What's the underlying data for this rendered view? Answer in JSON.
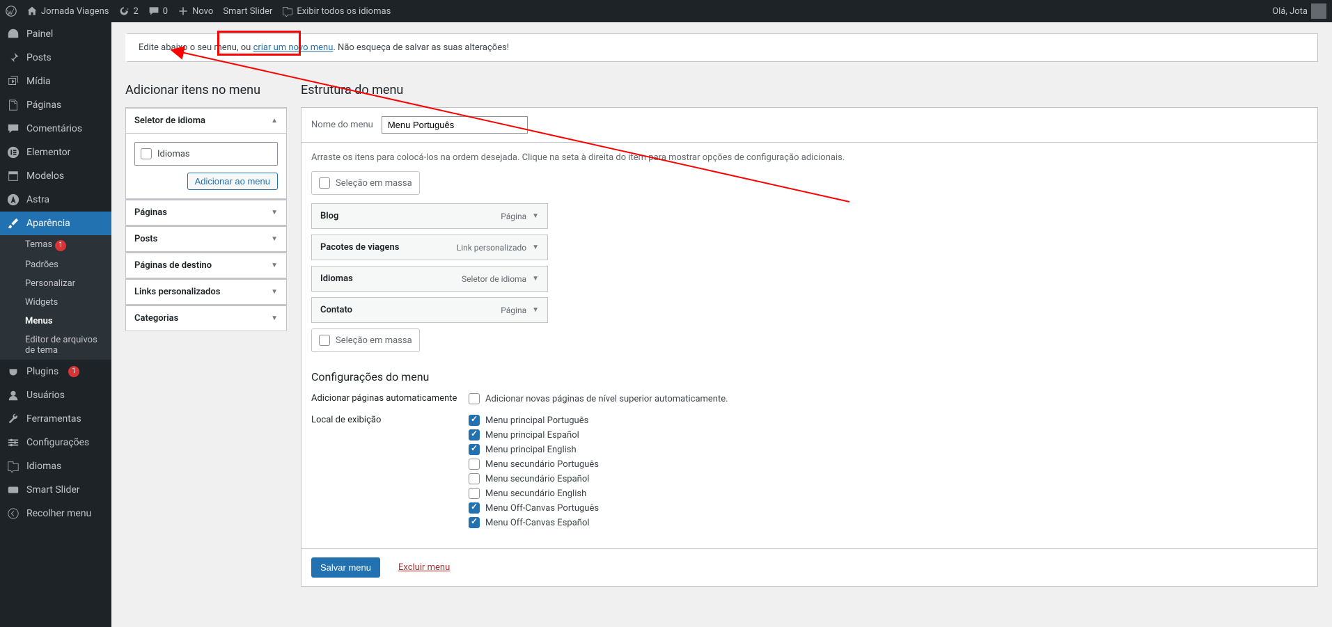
{
  "adminbar": {
    "site": "Jornada Viagens",
    "updates": "2",
    "comments": "0",
    "new": "Novo",
    "smartslider": "Smart Slider",
    "showall": "Exibir todos os idiomas",
    "greeting": "Olá, Jota"
  },
  "sidemenu": {
    "dashboard": "Painel",
    "posts": "Posts",
    "media": "Mídia",
    "pages": "Páginas",
    "comments": "Comentários",
    "elementor": "Elementor",
    "templates": "Modelos",
    "astra": "Astra",
    "appearance": "Aparência",
    "appearance_sub": {
      "themes": "Temas",
      "themes_badge": "1",
      "patterns": "Padrões",
      "customize": "Personalizar",
      "widgets": "Widgets",
      "menus": "Menus",
      "editor": "Editor de arquivos de tema"
    },
    "plugins": "Plugins",
    "plugins_badge": "1",
    "users": "Usuários",
    "tools": "Ferramentas",
    "settings": "Configurações",
    "languages": "Idiomas",
    "smartslider": "Smart Slider",
    "collapse": "Recolher menu"
  },
  "notice": {
    "pre": "Edite abaixo o seu menu, ou ",
    "link": "criar um novo menu",
    "post": ". Não esqueça de salvar as suas alterações!"
  },
  "left": {
    "heading": "Adicionar itens no menu",
    "boxes": {
      "lang": "Seletor de idioma",
      "lang_option": "Idiomas",
      "add_btn": "Adicionar ao menu",
      "pages": "Páginas",
      "posts": "Posts",
      "landing": "Páginas de destino",
      "custom": "Links personalizados",
      "cats": "Categorias"
    }
  },
  "right": {
    "heading": "Estrutura do menu",
    "name_label": "Nome do menu",
    "name_value": "Menu Português",
    "drag_hint": "Arraste os itens para colocá-los na ordem desejada. Clique na seta à direita do item para mostrar opções de configuração adicionais.",
    "bulk": "Seleção em massa",
    "items": [
      {
        "title": "Blog",
        "type": "Página"
      },
      {
        "title": "Pacotes de viagens",
        "type": "Link personalizado"
      },
      {
        "title": "Idiomas",
        "type": "Seletor de idioma"
      },
      {
        "title": "Contato",
        "type": "Página"
      }
    ],
    "settings_heading": "Configurações do menu",
    "auto_add_label": "Adicionar páginas automaticamente",
    "auto_add_check": "Adicionar novas páginas de nível superior automaticamente.",
    "display_label": "Local de exibição",
    "locations": [
      {
        "label": "Menu principal Português",
        "checked": true
      },
      {
        "label": "Menu principal Español",
        "checked": true
      },
      {
        "label": "Menu principal English",
        "checked": true
      },
      {
        "label": "Menu secundário Português",
        "checked": false
      },
      {
        "label": "Menu secundário Español",
        "checked": false
      },
      {
        "label": "Menu secundário English",
        "checked": false
      },
      {
        "label": "Menu Off-Canvas Português",
        "checked": true
      },
      {
        "label": "Menu Off-Canvas Español",
        "checked": true
      }
    ],
    "save": "Salvar menu",
    "delete": "Excluir menu"
  }
}
